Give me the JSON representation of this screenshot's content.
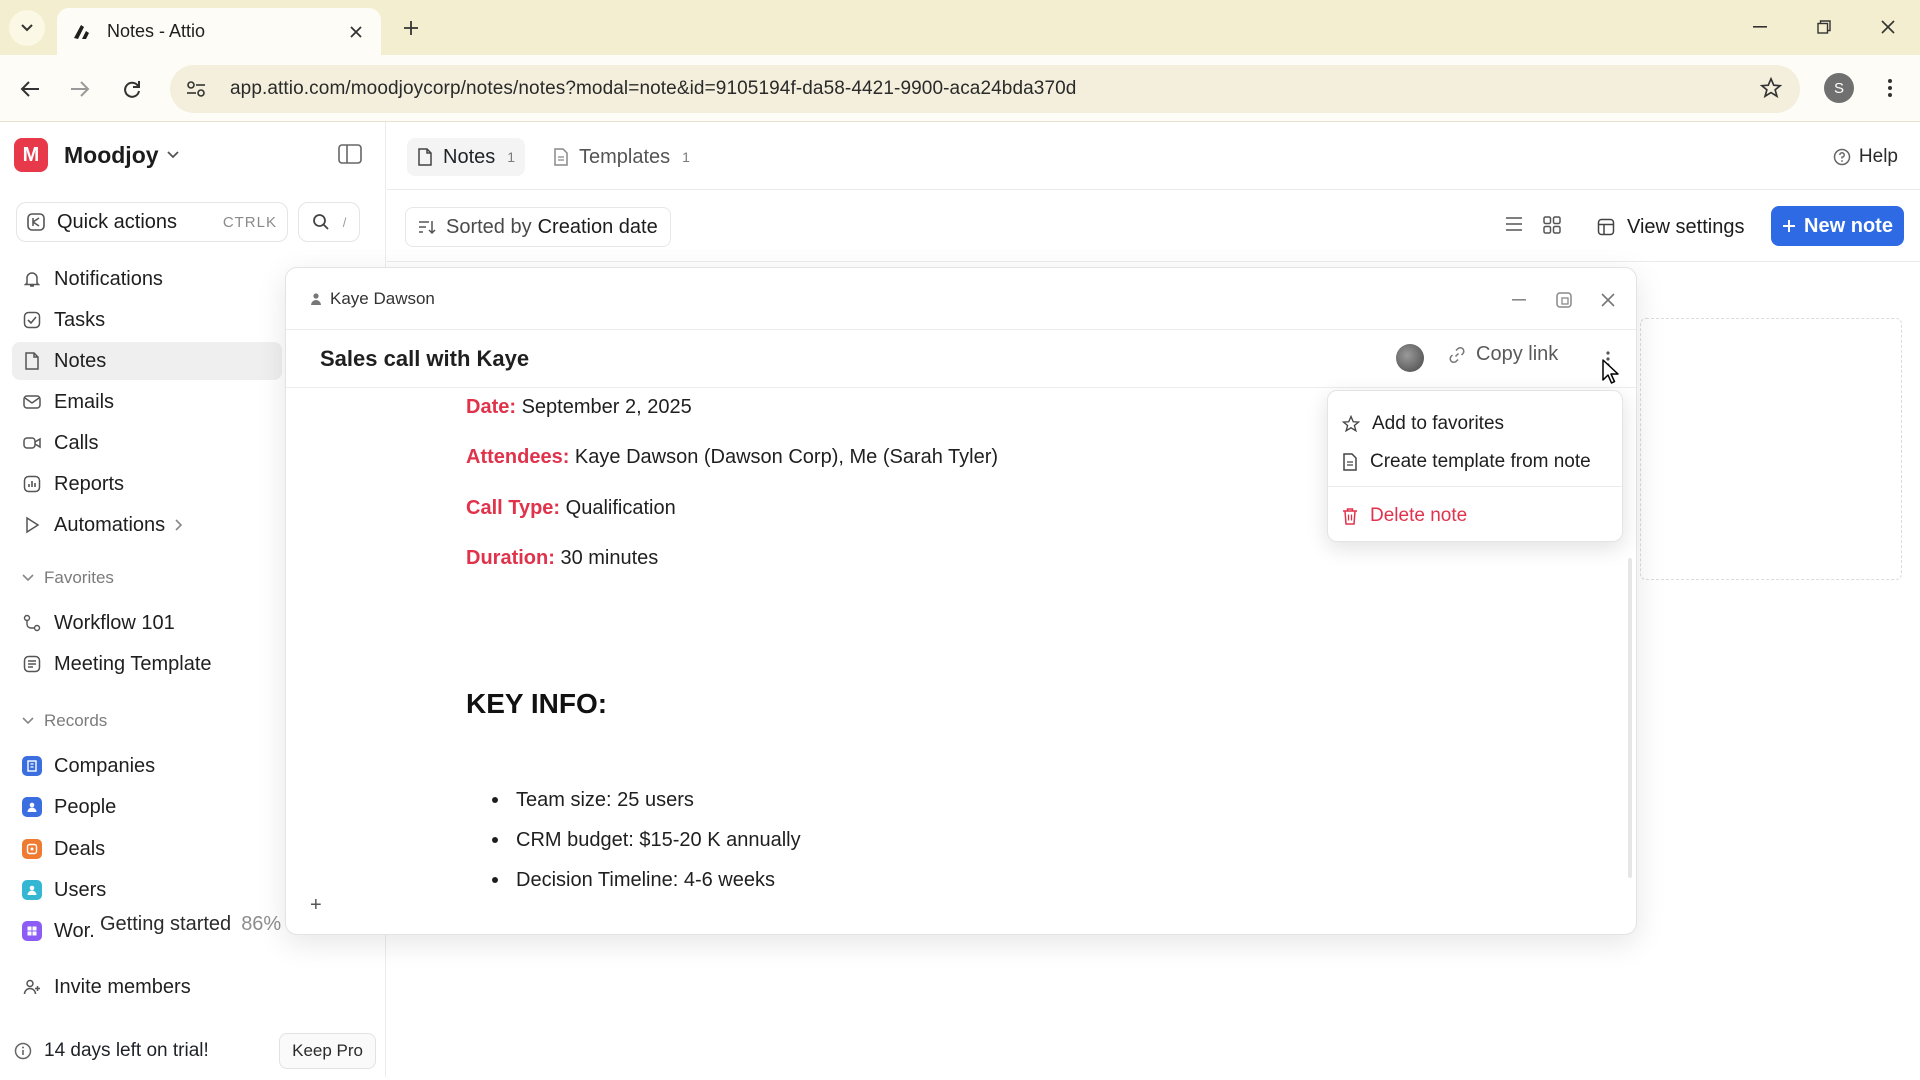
{
  "browser": {
    "tab_title": "Notes - Attio",
    "url": "app.attio.com/moodjoycorp/notes/notes?modal=note&id=9105194f-da58-4421-9900-aca24bda370d",
    "profile_initial": "S"
  },
  "sidebar": {
    "workspace_initial": "M",
    "workspace_name": "Moodjoy",
    "quick_actions_label": "Quick actions",
    "quick_actions_shortcut": "CTRLK",
    "search_shortcut": "/",
    "nav": [
      {
        "label": "Notifications",
        "icon": "bell-icon"
      },
      {
        "label": "Tasks",
        "icon": "checkbox-icon"
      },
      {
        "label": "Notes",
        "icon": "document-icon"
      },
      {
        "label": "Emails",
        "icon": "mail-icon"
      },
      {
        "label": "Calls",
        "icon": "video-icon"
      },
      {
        "label": "Reports",
        "icon": "chart-icon"
      },
      {
        "label": "Automations",
        "icon": "play-icon"
      }
    ],
    "favorites_label": "Favorites",
    "favorites": [
      {
        "label": "Workflow 101",
        "icon": "workflow-icon"
      },
      {
        "label": "Meeting Template",
        "icon": "template-icon"
      }
    ],
    "records_label": "Records",
    "records": [
      {
        "label": "Companies",
        "color": "#3b6fe0"
      },
      {
        "label": "People",
        "color": "#3b6fe0"
      },
      {
        "label": "Deals",
        "color": "#ef7a32"
      },
      {
        "label": "Users",
        "color": "#35b6d3"
      },
      {
        "label": "Wor...",
        "color": "#8b5cf6"
      }
    ],
    "tooltip_label": "Getting started",
    "tooltip_percent": "86%",
    "invite_label": "Invite members",
    "trial_label": "14 days left on trial!",
    "keep_pro_label": "Keep Pro"
  },
  "header": {
    "tabs": [
      {
        "label": "Notes",
        "count": "1"
      },
      {
        "label": "Templates",
        "count": "1"
      }
    ],
    "help_label": "Help",
    "sort_prefix": "Sorted by",
    "sort_value": "Creation date",
    "view_settings_label": "View settings",
    "new_note_label": "New note"
  },
  "modal": {
    "breadcrumb": "Kaye Dawson",
    "title": "Sales call with Kaye",
    "copy_link_label": "Copy link",
    "fields": [
      {
        "key": "Date:",
        "value": "September 2, 2025"
      },
      {
        "key": "Attendees:",
        "value": "Kaye Dawson (Dawson Corp), Me (Sarah Tyler)"
      },
      {
        "key": "Call Type:",
        "value": "Qualification"
      },
      {
        "key": "Duration:",
        "value": "30 minutes"
      }
    ],
    "key_info_heading": "KEY INFO:",
    "bullets": [
      "Team size: 25 users",
      "CRM budget: $15-20 K annually",
      "Decision Timeline: 4-6 weeks"
    ],
    "add_block": "+"
  },
  "menu": {
    "items": [
      {
        "label": "Add to favorites",
        "icon": "star-icon"
      },
      {
        "label": "Create template from note",
        "icon": "template-icon"
      },
      {
        "label": "Delete note",
        "icon": "trash-icon"
      }
    ]
  },
  "colors": {
    "accent": "#2f6ae5",
    "danger": "#e0334b",
    "workspace": "#e8394a",
    "chrome": "#f3eecf"
  }
}
